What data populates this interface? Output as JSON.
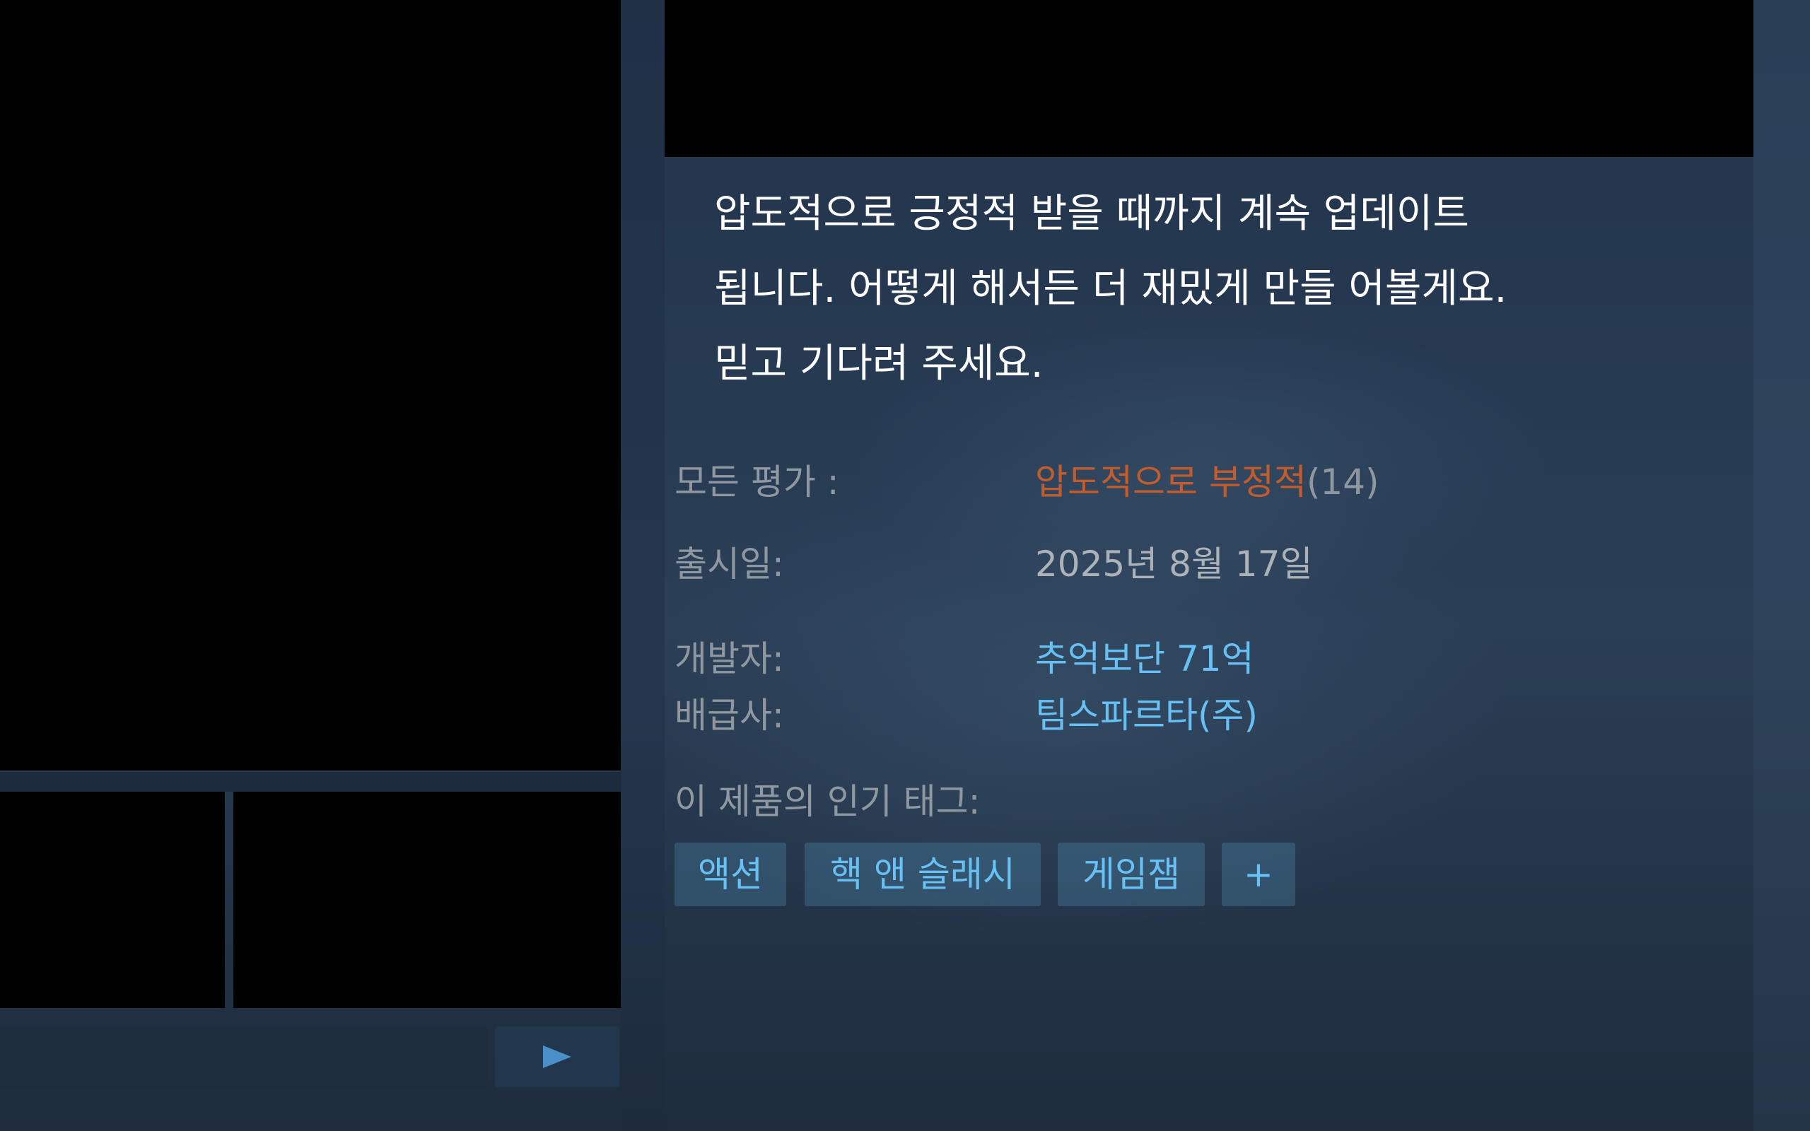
{
  "description": "압도적으로 긍정적 받을 때까지 계속 업데이트\n됩니다. 어떻게 해서든 더 재밌게 만들 어볼게요.\n믿고 기다려 주세요.",
  "info": {
    "reviews_label": "모든 평가 :",
    "reviews_rating": "압도적으로 부정적",
    "reviews_count": "(14)",
    "release_label": "출시일:",
    "release_date": "2025년 8월 17일",
    "developer_label": "개발자:",
    "developer": "추억보단 71억",
    "publisher_label": "배급사:",
    "publisher": "팀스파르타(주)"
  },
  "tags": {
    "label": "이 제품의 인기 태그:",
    "items": [
      "액션",
      "핵 앤 슬래시",
      "게임잼"
    ],
    "more": "+"
  },
  "icons": {
    "scroll_next": "play-arrow-icon"
  },
  "colors": {
    "rating_negative": "#c35c2c",
    "link": "#66c0f4",
    "tag_text": "#67c1f5"
  }
}
